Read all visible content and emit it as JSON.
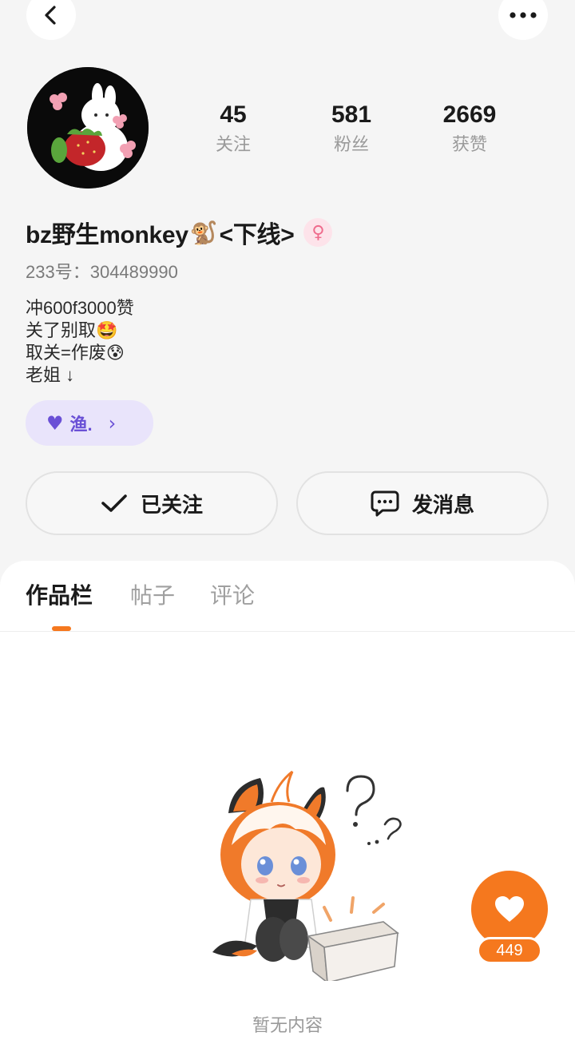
{
  "profile": {
    "name": "bz野生monkey",
    "name_emoji": "🐒",
    "name_suffix": "<下线>",
    "gender_symbol": "♀",
    "uid_label": "233号：",
    "uid": "304489990",
    "bio": [
      "冲600f3000赞",
      "关了别取🤩",
      "取关=作废😰",
      "老姐 ↓"
    ],
    "tag": {
      "heart": "💜",
      "label": "渔.",
      "arrow": "›"
    }
  },
  "stats": {
    "follow": {
      "value": "45",
      "label": "关注"
    },
    "fans": {
      "value": "581",
      "label": "粉丝"
    },
    "likes": {
      "value": "2669",
      "label": "获赞"
    }
  },
  "actions": {
    "follow_label": "已关注",
    "message_label": "发消息"
  },
  "tabs": [
    {
      "label": "作品栏",
      "active": true
    },
    {
      "label": "帖子",
      "active": false
    },
    {
      "label": "评论",
      "active": false
    }
  ],
  "empty": {
    "text": "暂无内容"
  },
  "fab": {
    "count": "449"
  },
  "colors": {
    "accent": "#f5781e",
    "tag_bg": "#e9e4fb",
    "tag_fg": "#6a50d6",
    "gender_bg": "#fde3ea",
    "gender_fg": "#ef6b8c"
  },
  "icons": {
    "back": "chevron-left-icon",
    "more": "more-dots-icon",
    "check": "check-icon",
    "message": "chat-bubble-icon",
    "like": "heart-icon"
  }
}
